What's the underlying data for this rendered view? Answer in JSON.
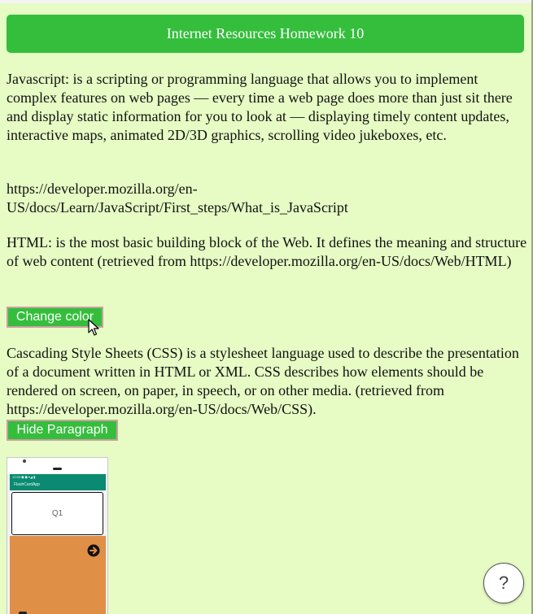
{
  "header": {
    "title": "Internet Resources Homework 10"
  },
  "paragraphs": {
    "javascript": "Javascript: is a scripting or programming language that allows you to implement complex features on web pages — every time a web page does more than just sit there and display static information for you to look at — displaying timely content updates, interactive maps, animated 2D/3D graphics, scrolling video jukeboxes, etc.",
    "javascript_link": "https://developer.mozilla.org/en-US/docs/Learn/JavaScript/First_steps/What_is_JavaScript",
    "html": "HTML: is the most basic building block of the Web. It defines the meaning and structure of web content (retrieved from https://developer.mozilla.org/en-US/docs/Web/HTML)",
    "css": "Cascading Style Sheets (CSS) is a stylesheet language used to describe the presentation of a document written in HTML or XML. CSS describes how elements should be rendered on screen, on paper, in speech, or on other media. (retrieved from https://developer.mozilla.org/en-US/docs/Web/CSS)."
  },
  "buttons": {
    "change_color": "Change color",
    "hide_paragraph": "Hide Paragraph",
    "help": "?"
  },
  "phone_screenshot": {
    "status_bar": "12:59 ◼ ◼       ▾◢ ▮",
    "app_title": "FlashCardApp",
    "card_text": "Q1",
    "next_icon": "arrow-right-circle-icon"
  },
  "colors": {
    "background": "#e6fcc4",
    "accent_green": "#34be3c",
    "app_bar": "#0a8a71",
    "app_body": "#e08f46"
  }
}
